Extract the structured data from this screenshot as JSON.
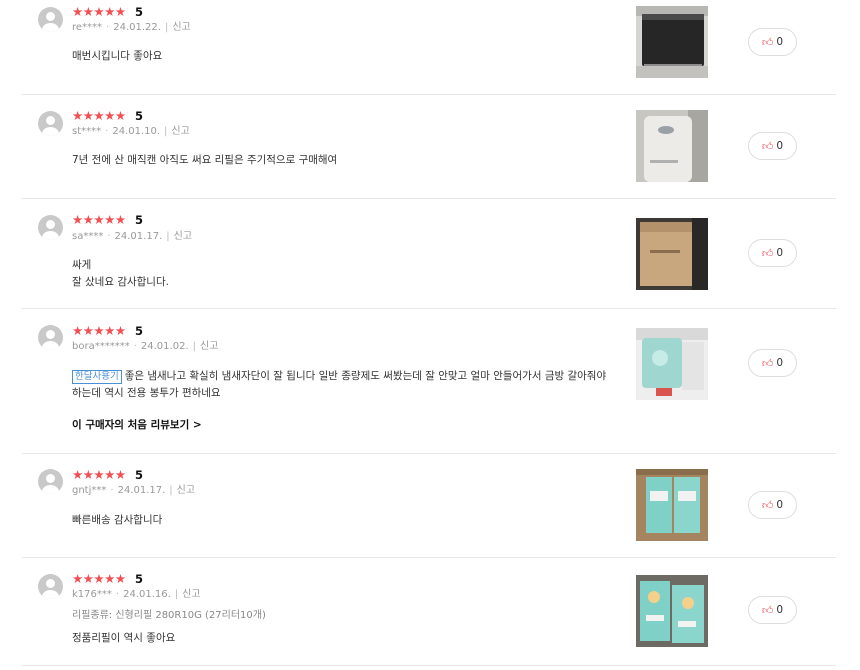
{
  "reviews": [
    {
      "stars": "★★★★★",
      "score": "5",
      "user": "re****",
      "date": "24.01.22.",
      "report": "신고",
      "option": "",
      "tag": "",
      "text": "매번시킵니다 좋아요",
      "more": "",
      "likes": "0",
      "photo": "trash-can-black-photo"
    },
    {
      "stars": "★★★★★",
      "score": "5",
      "user": "st****",
      "date": "24.01.10.",
      "report": "신고",
      "option": "",
      "tag": "",
      "text": "7년 전에 산 매직캔 아직도 써요 리필은 주기적으로 구매해여",
      "more": "",
      "likes": "0",
      "photo": "trash-can-white-photo"
    },
    {
      "stars": "★★★★★",
      "score": "5",
      "user": "sa****",
      "date": "24.01.17.",
      "report": "신고",
      "option": "",
      "tag": "",
      "text": "싸게\n잘 샀네요 감사합니다.",
      "more": "",
      "likes": "0",
      "photo": "delivery-box-photo"
    },
    {
      "stars": "★★★★★",
      "score": "5",
      "user": "bora*******",
      "date": "24.01.02.",
      "report": "신고",
      "option": "",
      "tag": "한달사용기",
      "text": "좋은 냄새나고 확실히 냄새자단이 잘 됩니다 일반 종량제도 써봤는데 잘 안맞고 얼마 안들어가서 금방 갈아줘야 하는데 역시 전용 봉투가 편하네요",
      "more": "이 구매자의 처음 리뷰보기",
      "likes": "0",
      "photo": "refill-bag-photo"
    },
    {
      "stars": "★★★★★",
      "score": "5",
      "user": "gntj***",
      "date": "24.01.17.",
      "report": "신고",
      "option": "",
      "tag": "",
      "text": "빠른배송 감사합니다",
      "more": "",
      "likes": "0",
      "photo": "refill-packages-photo"
    },
    {
      "stars": "★★★★★",
      "score": "5",
      "user": "k176***",
      "date": "24.01.16.",
      "report": "신고",
      "option": "리필종류: 신형리필 280R10G (27리터10개)",
      "tag": "",
      "text": "정품리필이 역시 좋아요",
      "more": "",
      "likes": "0",
      "photo": "refill-stack-photo"
    }
  ],
  "colors": {
    "star": "#f24f54",
    "tag": "#4a90d9"
  },
  "icons": {
    "like": "thumbs-up-icon",
    "avatar": "user-avatar-icon",
    "more": "chevron-right-icon"
  }
}
